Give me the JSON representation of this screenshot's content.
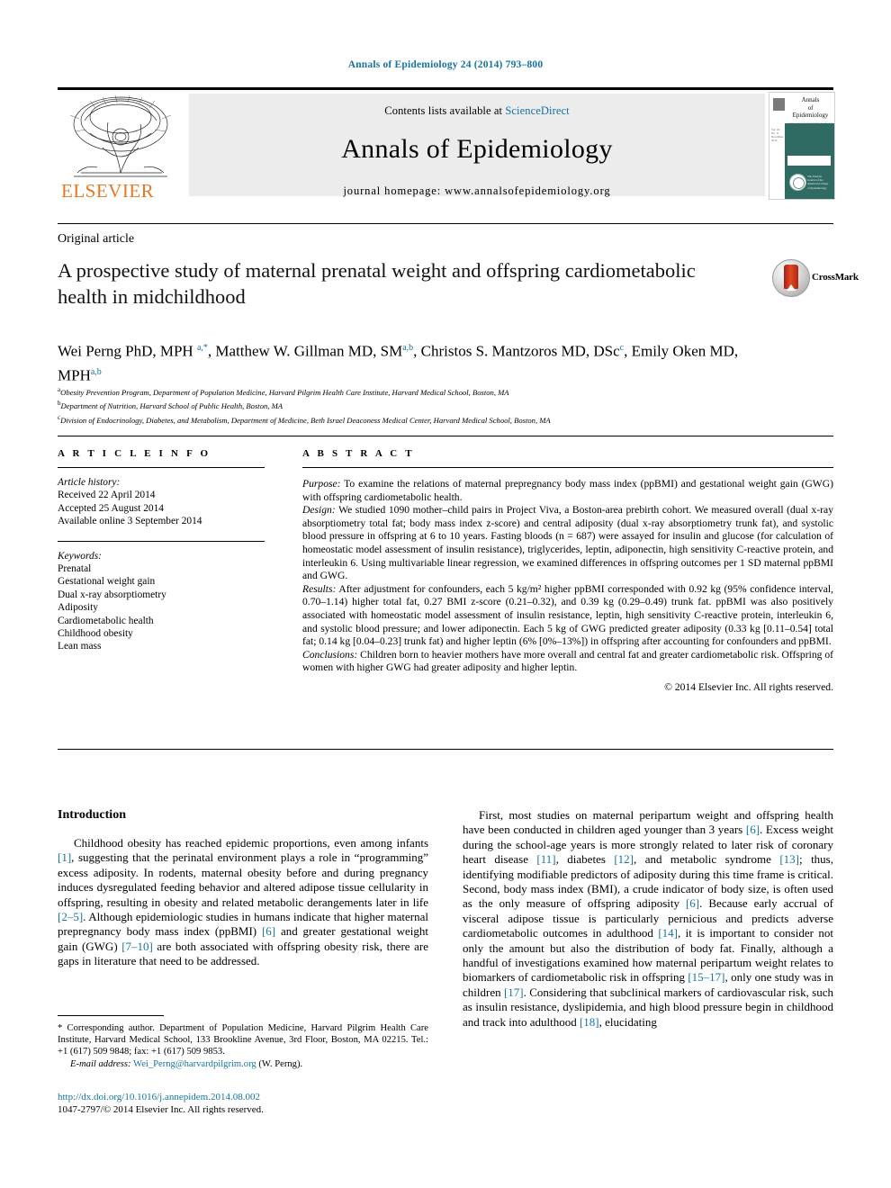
{
  "running_head": "Annals of Epidemiology 24 (2014) 793–800",
  "banner": {
    "contents_prefix": "Contents lists available at ",
    "sciencedirect": "ScienceDirect",
    "journal_name": "Annals of Epidemiology",
    "homepage": "journal homepage: www.annalsofepidemiology.org",
    "publisher_wordmark": "ELSEVIER",
    "cover": {
      "title_line1": "Annals",
      "title_line2": "of",
      "title_line3": "Epidemiology",
      "title_sub": "www.annalsofepidemiology.org",
      "sidebar_text": "Vol. 24  No. 11  November 2014",
      "seal_text": "The Elsevier Journal of the American College of Epidemiology"
    }
  },
  "article": {
    "type": "Original article",
    "title": "A prospective study of maternal prenatal weight and offspring cardiometabolic health in midchildhood",
    "crossmark_label": "CrossMark",
    "authors_html": "Wei Perng PhD, MPH <sup>a,*</sup>, Matthew W. Gillman MD, SM<sup>a,b</sup>, Christos S. Mantzoros MD, DSc<sup>c</sup>, Emily Oken MD, MPH<sup>a,b</sup>",
    "affiliations": [
      {
        "marker": "a",
        "text": "Obesity Prevention Program, Department of Population Medicine, Harvard Pilgrim Health Care Institute, Harvard Medical School, Boston, MA"
      },
      {
        "marker": "b",
        "text": "Department of Nutrition, Harvard School of Public Health, Boston, MA"
      },
      {
        "marker": "c",
        "text": "Division of Endocrinology, Diabetes, and Metabolism, Department of Medicine, Beth Israel Deaconess Medical Center, Harvard Medical School, Boston, MA"
      }
    ]
  },
  "article_info": {
    "heading": "A R T I C L E    I N F O",
    "history_label": "Article history:",
    "history": [
      "Received 22 April 2014",
      "Accepted 25 August 2014",
      "Available online 3 September 2014"
    ],
    "keywords_label": "Keywords:",
    "keywords": [
      "Prenatal",
      "Gestational weight gain",
      "Dual x-ray absorptiometry",
      "Adiposity",
      "Cardiometabolic health",
      "Childhood obesity",
      "Lean mass"
    ]
  },
  "abstract": {
    "heading": "A B S T R A C T",
    "sections": [
      {
        "label": "Purpose:",
        "text": " To examine the relations of maternal prepregnancy body mass index (ppBMI) and gestational weight gain (GWG) with offspring cardiometabolic health."
      },
      {
        "label": "Design:",
        "text": " We studied 1090 mother–child pairs in Project Viva, a Boston-area prebirth cohort. We measured overall (dual x-ray absorptiometry total fat; body mass index z-score) and central adiposity (dual x-ray absorptiometry trunk fat), and systolic blood pressure in offspring at 6 to 10 years. Fasting bloods (n = 687) were assayed for insulin and glucose (for calculation of homeostatic model assessment of insulin resistance), triglycerides, leptin, adiponectin, high sensitivity C-reactive protein, and interleukin 6. Using multivariable linear regression, we examined differences in offspring outcomes per 1 SD maternal ppBMI and GWG."
      },
      {
        "label": "Results:",
        "text": " After adjustment for confounders, each 5 kg/m² higher ppBMI corresponded with 0.92 kg (95% confidence interval, 0.70–1.14) higher total fat, 0.27 BMI z-score (0.21–0.32), and 0.39 kg (0.29–0.49) trunk fat. ppBMI was also positively associated with homeostatic model assessment of insulin resistance, leptin, high sensitivity C-reactive protein, interleukin 6, and systolic blood pressure; and lower adiponectin. Each 5 kg of GWG predicted greater adiposity (0.33 kg [0.11–0.54] total fat; 0.14 kg [0.04–0.23] trunk fat) and higher leptin (6% [0%–13%]) in offspring after accounting for confounders and ppBMI."
      },
      {
        "label": "Conclusions:",
        "text": " Children born to heavier mothers have more overall and central fat and greater cardiometabolic risk. Offspring of women with higher GWG had greater adiposity and higher leptin."
      }
    ],
    "copyright": "© 2014 Elsevier Inc. All rights reserved."
  },
  "body": {
    "intro_heading": "Introduction",
    "left_paragraph_parts": [
      "Childhood obesity has reached epidemic proportions, even among infants ",
      "[1]",
      ", suggesting that the perinatal environment plays a role in “programming” excess adiposity. In rodents, maternal obesity before and during pregnancy induces dysregulated feeding behavior and altered adipose tissue cellularity in offspring, resulting in obesity and related metabolic derangements later in life ",
      "[2–5]",
      ". Although epidemiologic studies in humans indicate that higher maternal prepregnancy body mass index (ppBMI) ",
      "[6]",
      " and greater gestational weight gain (GWG) ",
      "[7–10]",
      " are both associated with offspring obesity risk, there are gaps in literature that need to be addressed."
    ],
    "right_paragraph_parts": [
      "First, most studies on maternal peripartum weight and offspring health have been conducted in children aged younger than 3 years ",
      "[6]",
      ". Excess weight during the school-age years is more strongly related to later risk of coronary heart disease ",
      "[11]",
      ", diabetes ",
      "[12]",
      ", and metabolic syndrome ",
      "[13]",
      "; thus, identifying modifiable predictors of adiposity during this time frame is critical. Second, body mass index (BMI), a crude indicator of body size, is often used as the only measure of offspring adiposity ",
      "[6]",
      ". Because early accrual of visceral adipose tissue is particularly pernicious and predicts adverse cardiometabolic outcomes in adulthood ",
      "[14]",
      ", it is important to consider not only the amount but also the distribution of body fat. Finally, although a handful of investigations examined how maternal peripartum weight relates to biomarkers of cardiometabolic risk in offspring ",
      "[15–17]",
      ", only one study was in children ",
      "[17]",
      ". Considering that subclinical markers of cardiovascular risk, such as insulin resistance, dyslipidemia, and high blood pressure begin in childhood and track into adulthood ",
      "[18]",
      ", elucidating"
    ]
  },
  "footnote": {
    "corresponding": "* Corresponding author. Department of Population Medicine, Harvard Pilgrim Health Care Institute, Harvard Medical School, 133 Brookline Avenue, 3rd Floor, Boston, MA 02215. Tel.: +1 (617) 509 9848; fax: +1 (617) 509 9853.",
    "email_label": "E-mail address:",
    "email": "Wei_Perng@harvardpilgrim.org",
    "email_suffix": " (W. Perng).",
    "doi": "http://dx.doi.org/10.1016/j.annepidem.2014.08.002",
    "issn_line": "1047-2797/© 2014 Elsevier Inc. All rights reserved."
  },
  "colors": {
    "link_blue": "#1474a4",
    "elsevier_orange": "#e87722",
    "banner_gray": "#ececec",
    "cover_teal": "#2f6b63"
  }
}
